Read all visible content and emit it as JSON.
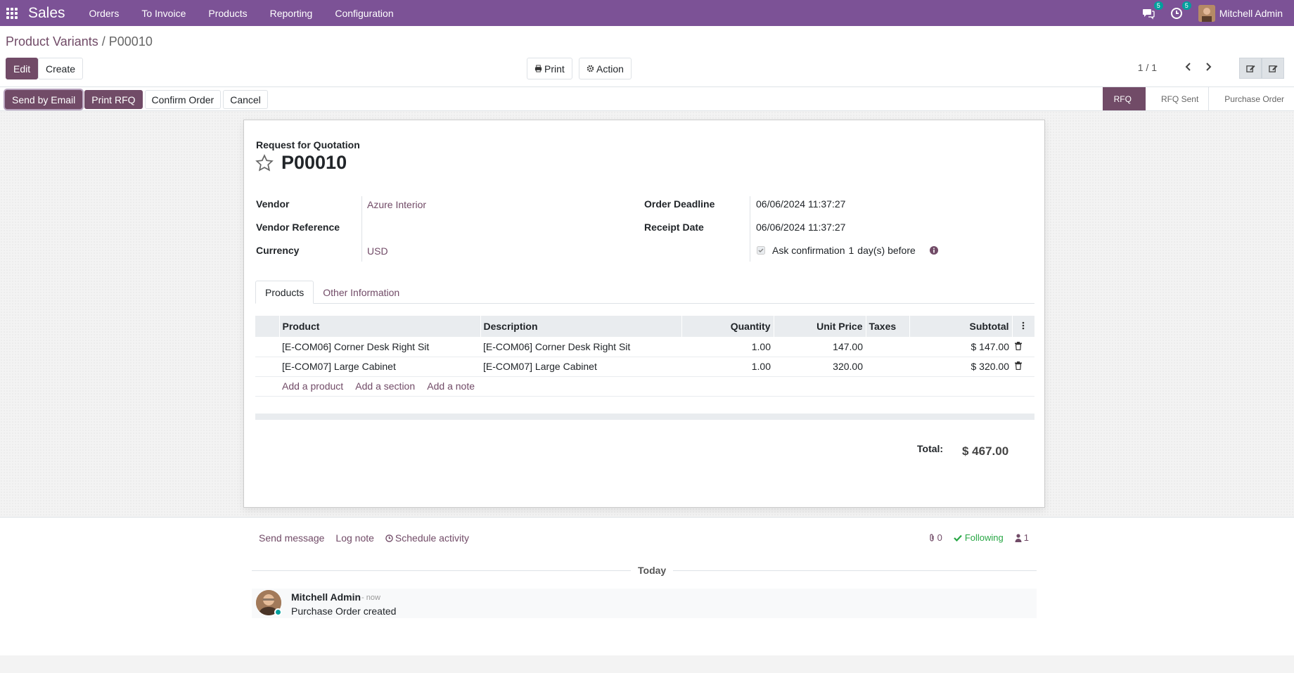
{
  "navbar": {
    "app_name": "Sales",
    "menu": [
      "Orders",
      "To Invoice",
      "Products",
      "Reporting",
      "Configuration"
    ],
    "messages_badge": "5",
    "activities_badge": "5",
    "user_name": "Mitchell Admin"
  },
  "breadcrumb": {
    "parent": "Product Variants",
    "separator": "/",
    "current": "P00010"
  },
  "control_panel": {
    "edit_label": "Edit",
    "create_label": "Create",
    "print_label": "Print",
    "action_label": "Action",
    "pager": "1 / 1"
  },
  "statusbar": {
    "buttons": [
      "Send by Email",
      "Print RFQ",
      "Confirm Order",
      "Cancel"
    ],
    "stages": [
      "RFQ",
      "RFQ Sent",
      "Purchase Order"
    ],
    "active_stage": "RFQ"
  },
  "form": {
    "doc_type": "Request for Quotation",
    "title": "P00010",
    "vendor_label": "Vendor",
    "vendor_value": "Azure Interior",
    "vendor_ref_label": "Vendor Reference",
    "vendor_ref_value": "",
    "currency_label": "Currency",
    "currency_value": "USD",
    "order_deadline_label": "Order Deadline",
    "order_deadline_value": "06/06/2024 11:37:27",
    "receipt_date_label": "Receipt Date",
    "receipt_date_value": "06/06/2024 11:37:27",
    "ask_confirmation_label": "Ask confirmation",
    "ask_confirmation_days": "1",
    "ask_confirmation_suffix": "day(s) before"
  },
  "tabs": [
    "Products",
    "Other Information"
  ],
  "lines": {
    "columns": [
      "Product",
      "Description",
      "Quantity",
      "Unit Price",
      "Taxes",
      "Subtotal"
    ],
    "rows": [
      {
        "product": "[E-COM06] Corner Desk Right Sit",
        "description": "[E-COM06] Corner Desk Right Sit",
        "quantity": "1.00",
        "unit_price": "147.00",
        "taxes": "",
        "subtotal": "$ 147.00"
      },
      {
        "product": "[E-COM07] Large Cabinet",
        "description": "[E-COM07] Large Cabinet",
        "quantity": "1.00",
        "unit_price": "320.00",
        "taxes": "",
        "subtotal": "$ 320.00"
      }
    ],
    "add_product": "Add a product",
    "add_section": "Add a section",
    "add_note": "Add a note"
  },
  "totals": {
    "label": "Total:",
    "value": "$ 467.00"
  },
  "chatter": {
    "send_message": "Send message",
    "log_note": "Log note",
    "schedule_activity": "Schedule activity",
    "attachments_count": "0",
    "following_label": "Following",
    "followers_count": "1",
    "today_label": "Today",
    "message_author": "Mitchell Admin",
    "message_time": "- now",
    "message_body": "Purchase Order created"
  },
  "colors": {
    "navbar": "#7C5296",
    "accent": "#714B67",
    "following": "#28a745"
  }
}
